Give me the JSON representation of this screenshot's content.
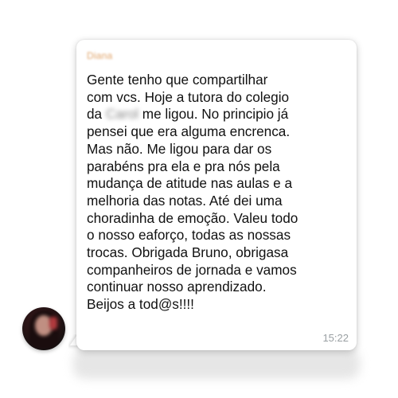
{
  "conversation": {
    "sender_name": "Diana",
    "timestamp": "15:22",
    "message_lines": [
      {
        "before": "Gente tenho que compartilhar",
        "name": "",
        "after": ""
      },
      {
        "before": "com vcs. Hoje a tutora do colegio",
        "name": "",
        "after": ""
      },
      {
        "before": "da ",
        "name": "Carol",
        "after": " me ligou. No principio já"
      },
      {
        "before": "pensei que era alguma encrenca.",
        "name": "",
        "after": ""
      },
      {
        "before": "Mas não. Me ligou para dar os",
        "name": "",
        "after": ""
      },
      {
        "before": "parabéns pra ela e pra nós pela",
        "name": "",
        "after": ""
      },
      {
        "before": "mudança de atitude nas aulas e a",
        "name": "",
        "after": ""
      },
      {
        "before": "melhoria das notas. Até dei uma",
        "name": "",
        "after": ""
      },
      {
        "before": "choradinha de emoção. Valeu todo",
        "name": "",
        "after": ""
      },
      {
        "before": "o nosso eaforço, todas as nossas",
        "name": "",
        "after": ""
      },
      {
        "before": "trocas. Obrigada Bruno, obrigasa",
        "name": "",
        "after": ""
      },
      {
        "before": "companheiros de jornada e vamos",
        "name": "",
        "after": ""
      },
      {
        "before": "continuar nosso aprendizado.",
        "name": "",
        "after": ""
      },
      {
        "before": "Beijos a tod@s!!!!",
        "name": "",
        "after": ""
      }
    ]
  },
  "colors": {
    "bubble": "#ffffff",
    "sender_name": "#e0a46a",
    "message_text": "#111111",
    "timestamp": "#9aa0a3"
  },
  "icons": {
    "avatar": "contact-avatar-photo"
  }
}
